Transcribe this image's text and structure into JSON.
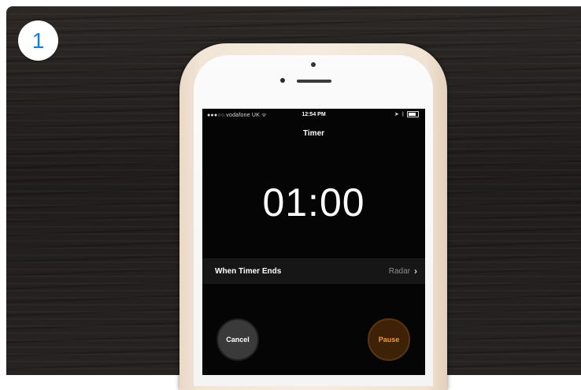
{
  "step": {
    "number": "1"
  },
  "status_bar": {
    "carrier": "●●●○○ vodafone UK ᯤ",
    "time": "12:54 PM"
  },
  "timer": {
    "title": "Timer",
    "display": "01:00",
    "when_ends_label": "When Timer Ends",
    "when_ends_value": "Radar"
  },
  "buttons": {
    "cancel": "Cancel",
    "pause": "Pause"
  },
  "colors": {
    "step_badge_text": "#1a7fd0",
    "pause_accent": "#f29a3a"
  }
}
